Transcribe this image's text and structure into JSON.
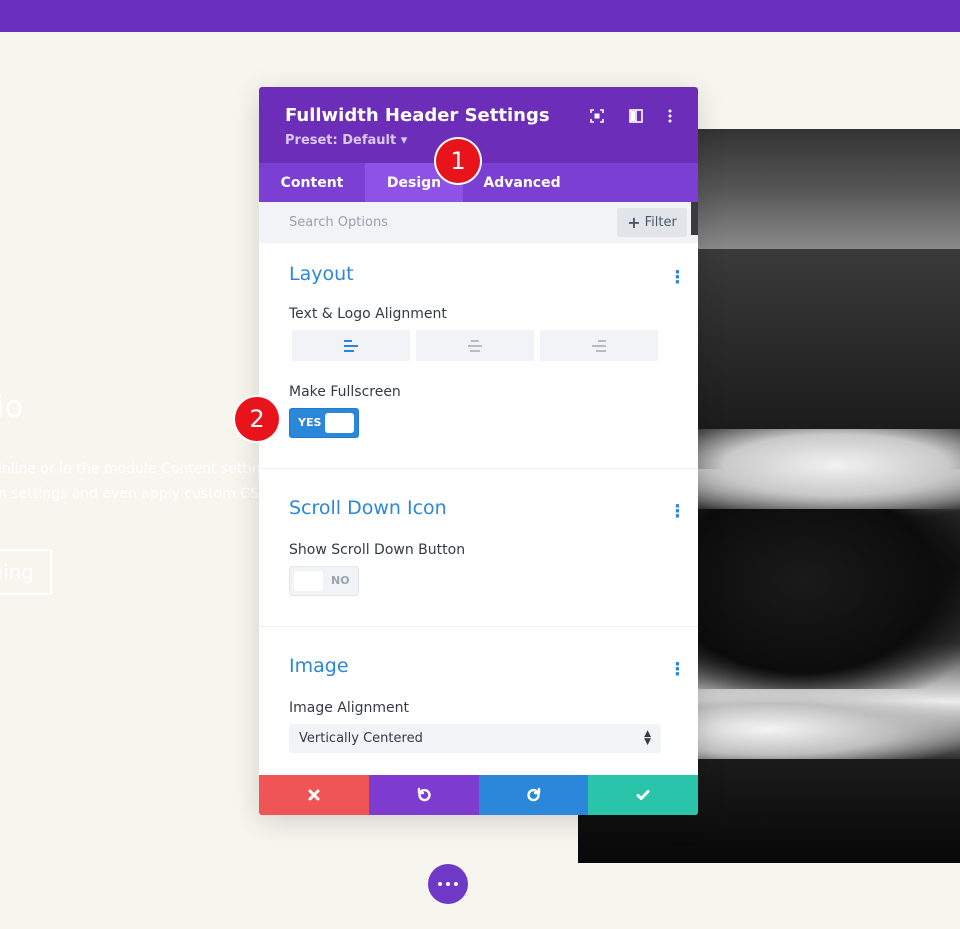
{
  "background": {
    "title_fragment": "io",
    "text_line_1": "inline or in the module Content settings",
    "text_line_2": "n settings and even apply custom CSS to",
    "button_fragment": "ning"
  },
  "panel": {
    "title": "Fullwidth Header Settings",
    "preset": "Preset: Default ▾",
    "header_icons": [
      "fullscreen-icon",
      "split-view-icon",
      "more-options-icon"
    ]
  },
  "tabs": [
    {
      "label": "Content",
      "active": false
    },
    {
      "label": "Design",
      "active": true
    },
    {
      "label": "Advanced",
      "active": false
    }
  ],
  "search": {
    "placeholder": "Search Options",
    "filter_label": "Filter"
  },
  "sections": {
    "layout": {
      "title": "Layout",
      "alignment_label": "Text & Logo Alignment",
      "alignment_options": [
        "left",
        "center",
        "right"
      ],
      "alignment_selected": "left",
      "fullscreen_label": "Make Fullscreen",
      "fullscreen_toggle": "YES"
    },
    "scroll_down": {
      "title": "Scroll Down Icon",
      "button_label": "Show Scroll Down Button",
      "button_toggle": "NO"
    },
    "image": {
      "title": "Image",
      "alignment_label": "Image Alignment",
      "alignment_value": "Vertically Centered"
    }
  },
  "footer_actions": [
    "cancel-icon",
    "undo-icon",
    "redo-icon",
    "save-icon"
  ],
  "annotations": [
    "1",
    "2"
  ],
  "colors": {
    "purple_header": "#6c2eb9",
    "accent_blue": "#2b87da",
    "cancel_red": "#ef5555",
    "save_green": "#29c4a9",
    "badge_red": "#e8131b"
  }
}
